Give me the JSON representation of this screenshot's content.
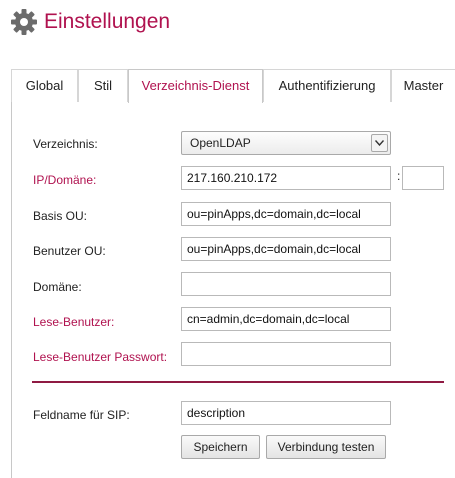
{
  "header": {
    "title": "Einstellungen",
    "icon": "gear-icon"
  },
  "tabs": [
    {
      "label": "Global",
      "active": false
    },
    {
      "label": "Stil",
      "active": false
    },
    {
      "label": "Verzeichnis-Dienst",
      "active": true
    },
    {
      "label": "Authentifizierung",
      "active": false
    },
    {
      "label": "Master",
      "active": false
    }
  ],
  "form": {
    "verzeichnis": {
      "label": "Verzeichnis:",
      "value": "OpenLDAP"
    },
    "ip": {
      "label": "IP/Domäne:",
      "value": "217.160.210.172",
      "port_separator": ":",
      "port_value": ""
    },
    "basis_ou": {
      "label": "Basis OU:",
      "value": "ou=pinApps,dc=domain,dc=local"
    },
    "benutzer_ou": {
      "label": "Benutzer OU:",
      "value": "ou=pinApps,dc=domain,dc=local"
    },
    "domaene": {
      "label": "Domäne:",
      "value": ""
    },
    "lese_benutzer": {
      "label": "Lese-Benutzer:",
      "value": "cn=admin,dc=domain,dc=local"
    },
    "lese_passwort": {
      "label": "Lese-Benutzer Passwort:",
      "value": ""
    },
    "sip_feld": {
      "label": "Feldname für SIP:",
      "value": "description"
    }
  },
  "buttons": {
    "save": "Speichern",
    "test": "Verbindung testen"
  },
  "colors": {
    "accent": "#b0124f",
    "divider": "#8f1a43"
  }
}
